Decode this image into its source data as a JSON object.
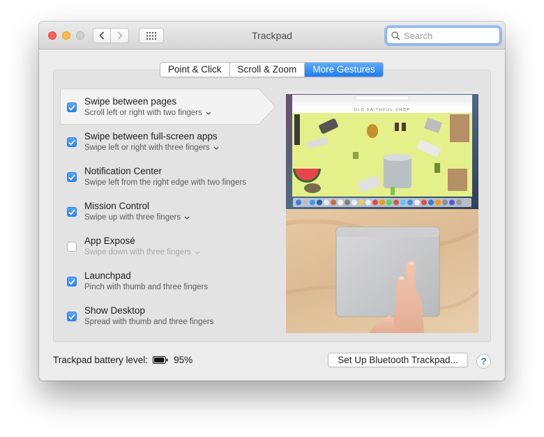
{
  "window": {
    "title": "Trackpad",
    "search_placeholder": "Search"
  },
  "tabs": [
    {
      "label": "Point & Click",
      "active": false
    },
    {
      "label": "Scroll & Zoom",
      "active": false
    },
    {
      "label": "More Gestures",
      "active": true
    }
  ],
  "gestures": [
    {
      "title": "Swipe between pages",
      "subtitle": "Scroll left or right with two fingers",
      "checked": true,
      "has_dropdown": true,
      "selected": true,
      "dimmed": false
    },
    {
      "title": "Swipe between full-screen apps",
      "subtitle": "Swipe left or right with three fingers",
      "checked": true,
      "has_dropdown": true,
      "selected": false,
      "dimmed": false
    },
    {
      "title": "Notification Center",
      "subtitle": "Swipe left from the right edge with two fingers",
      "checked": true,
      "has_dropdown": false,
      "selected": false,
      "dimmed": false
    },
    {
      "title": "Mission Control",
      "subtitle": "Swipe up with three fingers",
      "checked": true,
      "has_dropdown": true,
      "selected": false,
      "dimmed": false
    },
    {
      "title": "App Exposé",
      "subtitle": "Swipe down with three fingers",
      "checked": false,
      "has_dropdown": true,
      "selected": false,
      "dimmed": true
    },
    {
      "title": "Launchpad",
      "subtitle": "Pinch with thumb and three fingers",
      "checked": true,
      "has_dropdown": false,
      "selected": false,
      "dimmed": false
    },
    {
      "title": "Show Desktop",
      "subtitle": "Spread with thumb and three fingers",
      "checked": true,
      "has_dropdown": false,
      "selected": false,
      "dimmed": false
    }
  ],
  "preview": {
    "shop_name": "OLD FAITHFUL SHOP"
  },
  "footer": {
    "battery_label": "Trackpad battery level:",
    "battery_value": "95%",
    "battery_level": 0.95,
    "setup_button": "Set Up Bluetooth Trackpad...",
    "help_button": "?"
  },
  "colors": {
    "accent": "#2a86f5",
    "close": "#fc605b",
    "minimize": "#fdbc40"
  }
}
